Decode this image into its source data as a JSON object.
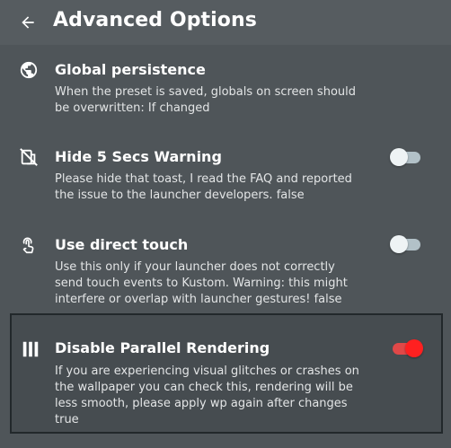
{
  "header": {
    "title": "Advanced Options"
  },
  "colors": {
    "background": "#4f5559",
    "toggle_on": "#ff2020",
    "toggle_off": "#eef3f5"
  },
  "settings": [
    {
      "icon": "globe-icon",
      "title": "Global persistence",
      "description": "When the preset is saved, globals on screen should be overwritten: If changed"
    },
    {
      "icon": "no-notifications-icon",
      "title": "Hide 5 Secs Warning",
      "description": "Please hide that toast, I read the FAQ and reported the issue to the launcher developers. false",
      "toggle": "off"
    },
    {
      "icon": "touch-icon",
      "title": "Use direct touch",
      "description": "Use this only if your launcher does not correctly send touch events to Kustom. Warning: this might interfere or overlap with launcher gestures! false",
      "toggle": "off"
    },
    {
      "icon": "parallel-bars-icon",
      "title": "Disable Parallel Rendering",
      "description": "If you are experiencing visual glitches or crashes on the wallpaper you can check this, rendering will be less smooth, please apply wp again after changes true",
      "toggle": "on"
    }
  ]
}
